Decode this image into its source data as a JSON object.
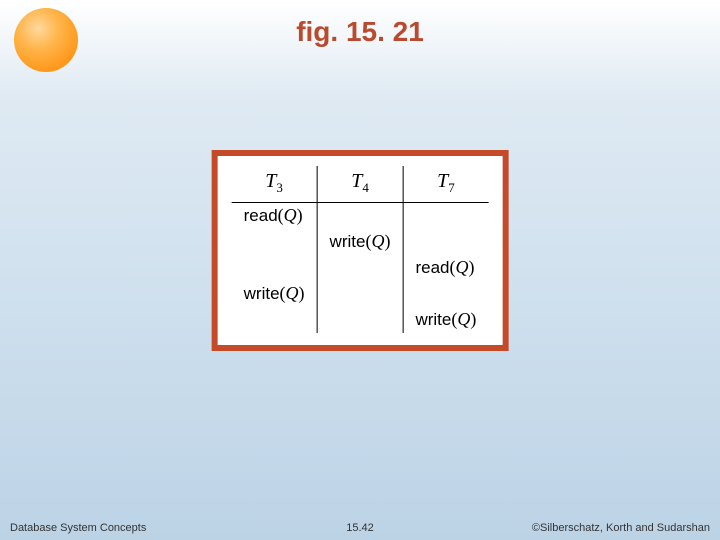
{
  "title": "fig. 15. 21",
  "schedule": {
    "columns": [
      {
        "name": "T",
        "sub": "3"
      },
      {
        "name": "T",
        "sub": "4"
      },
      {
        "name": "T",
        "sub": "7"
      }
    ],
    "rows": [
      {
        "c0": "read(Q)",
        "c1": "",
        "c2": ""
      },
      {
        "c0": "",
        "c1": "write(Q)",
        "c2": ""
      },
      {
        "c0": "",
        "c1": "",
        "c2": "read(Q)"
      },
      {
        "c0": "write(Q)",
        "c1": "",
        "c2": ""
      },
      {
        "c0": "",
        "c1": "",
        "c2": "write(Q)"
      }
    ]
  },
  "footer": {
    "left": "Database System Concepts",
    "center": "15.42",
    "right": "©Silberschatz, Korth and Sudarshan"
  },
  "chart_data": {
    "type": "table",
    "title": "fig. 15.21 — transaction schedule",
    "columns": [
      "T3",
      "T4",
      "T7"
    ],
    "rows": [
      [
        "read(Q)",
        "",
        ""
      ],
      [
        "",
        "write(Q)",
        ""
      ],
      [
        "",
        "",
        "read(Q)"
      ],
      [
        "write(Q)",
        "",
        ""
      ],
      [
        "",
        "",
        "write(Q)"
      ]
    ]
  }
}
